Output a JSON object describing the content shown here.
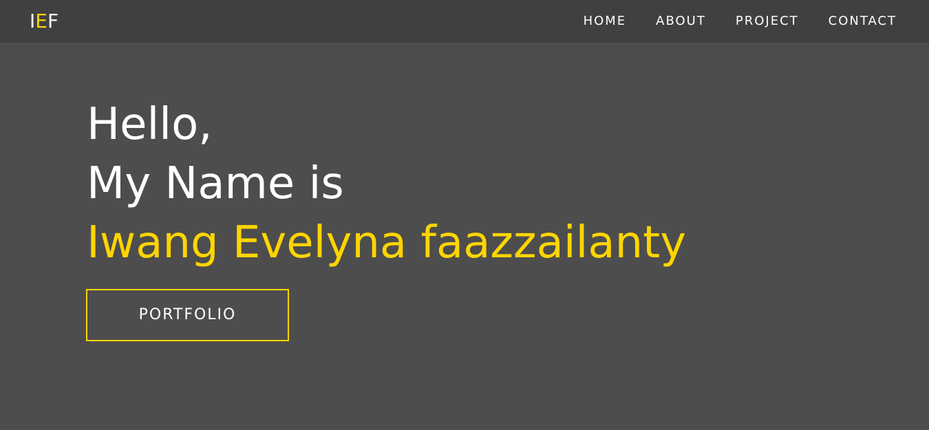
{
  "navbar": {
    "logo": {
      "part1": "I",
      "part2": "E",
      "part3": "F"
    },
    "links": [
      {
        "label": "HOME"
      },
      {
        "label": "ABOUT"
      },
      {
        "label": "PROJECT"
      },
      {
        "label": "CONTACT"
      }
    ]
  },
  "hero": {
    "line1": "Hello,",
    "line2": "My Name is",
    "name": "Iwang Evelyna faazzailanty",
    "button_label": "PORTFOLIO"
  },
  "colors": {
    "background": "#4d4d4d",
    "navbar": "#404040",
    "accent": "#ffd500",
    "text": "#ffffff"
  }
}
